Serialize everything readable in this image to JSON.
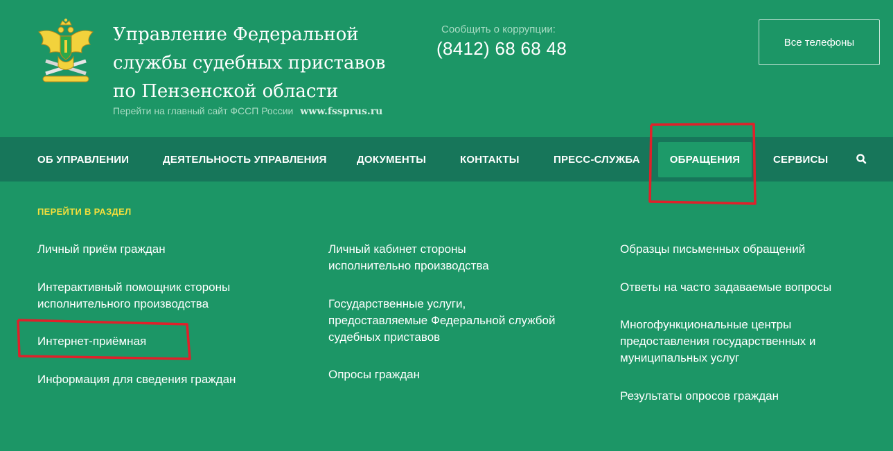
{
  "header": {
    "title_lines": [
      "Управление Федеральной",
      "службы судебных приставов",
      "по Пензенской области"
    ],
    "main_site_label": "Перейти на главный сайт ФССП России",
    "main_site_link": "www.fssprus.ru",
    "corruption_label": "Сообщить о коррупции:",
    "corruption_phone": "(8412) 68 68 48",
    "phones_button": "Все телефоны"
  },
  "nav": {
    "items": [
      {
        "label": "ОБ УПРАВЛЕНИИ"
      },
      {
        "label": "ДЕЯТЕЛЬНОСТЬ УПРАВЛЕНИЯ"
      },
      {
        "label": "ДОКУМЕНТЫ"
      },
      {
        "label": "КОНТАКТЫ"
      },
      {
        "label": "ПРЕСС-СЛУЖБА"
      },
      {
        "label": "ОБРАЩЕНИЯ",
        "active": true
      },
      {
        "label": "СЕРВИСЫ"
      }
    ],
    "search_icon": "search-icon"
  },
  "dropdown": {
    "section_label": "ПЕРЕЙТИ В РАЗДЕЛ",
    "col1": [
      {
        "lines": [
          "Личный приём граждан"
        ]
      },
      {
        "lines": [
          "Интерактивный помощник стороны",
          "исполнительного производства"
        ]
      },
      {
        "lines": [
          "Интернет-приёмная"
        ]
      },
      {
        "lines": [
          "Информация для сведения граждан"
        ]
      }
    ],
    "col2": [
      {
        "lines": [
          "Личный кабинет стороны",
          "исполнительно производства"
        ]
      },
      {
        "lines": [
          "Государственные услуги,",
          "предоставляемые Федеральной службой",
          "судебных приставов"
        ]
      },
      {
        "lines": [
          "Опросы граждан"
        ]
      }
    ],
    "col3": [
      {
        "lines": [
          "Образцы письменных обращений"
        ]
      },
      {
        "lines": [
          "Ответы на часто задаваемые вопросы"
        ]
      },
      {
        "lines": [
          "Многофункциональные центры",
          "предоставления государственных и",
          "муниципальных услуг"
        ]
      },
      {
        "lines": [
          "Результаты опросов граждан"
        ]
      }
    ]
  },
  "colors": {
    "background": "#1c9666",
    "nav_background": "#17765a",
    "active_tab": "#1d9a69",
    "section_label": "#f5df3c",
    "annotation": "#e0202a"
  }
}
